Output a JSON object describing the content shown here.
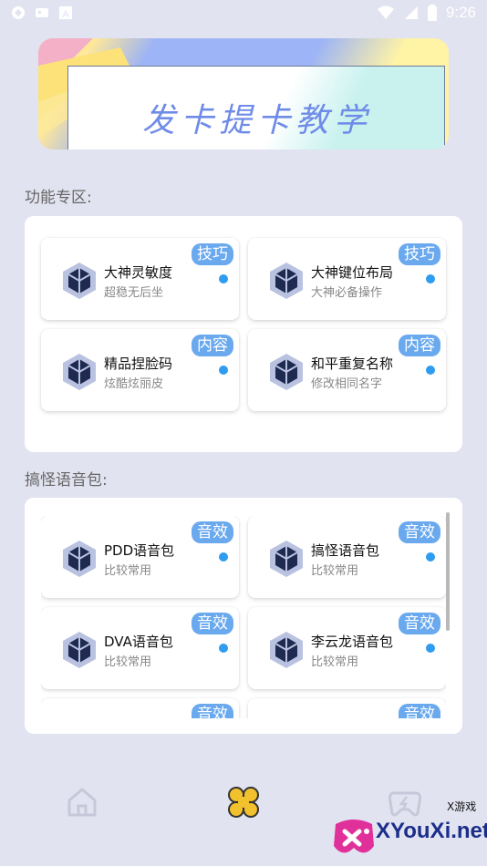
{
  "status_bar": {
    "time": "9:26",
    "battery_level": 0.85
  },
  "banner": {
    "title": "发卡提卡教学"
  },
  "sections": [
    {
      "title": "功能专区:",
      "cards": [
        {
          "name": "大神灵敏度",
          "sub": "超稳无后坐",
          "badge": "技巧"
        },
        {
          "name": "大神键位布局",
          "sub": "大神必备操作",
          "badge": "技巧"
        },
        {
          "name": "精品捏脸码",
          "sub": "炫酷炫丽皮",
          "badge": "内容"
        },
        {
          "name": "和平重复名称",
          "sub": "修改相同名字",
          "badge": "内容"
        }
      ]
    },
    {
      "title": "搞怪语音包:",
      "cards": [
        {
          "name": "PDD语音包",
          "sub": "比较常用",
          "badge": "音效"
        },
        {
          "name": "搞怪语音包",
          "sub": "比较常用",
          "badge": "音效"
        },
        {
          "name": "DVA语音包",
          "sub": "比较常用",
          "badge": "音效"
        },
        {
          "name": "李云龙语音包",
          "sub": "比较常用",
          "badge": "音效"
        },
        {
          "name": "",
          "sub": "",
          "badge": "音效"
        },
        {
          "name": "",
          "sub": "",
          "badge": "音效"
        }
      ]
    }
  ],
  "bottom_nav": {
    "items": [
      {
        "icon": "home-icon",
        "active": false
      },
      {
        "icon": "clover-icon",
        "active": true
      },
      {
        "icon": "gamepad-icon",
        "active": false
      }
    ]
  },
  "watermark": {
    "text": "XYouXi.net",
    "small": "X游戏"
  },
  "colors": {
    "background": "#e2e3f0",
    "badge": "#6aa9ee",
    "dot": "#2f9cf0",
    "active_nav": "#f2c12e"
  }
}
